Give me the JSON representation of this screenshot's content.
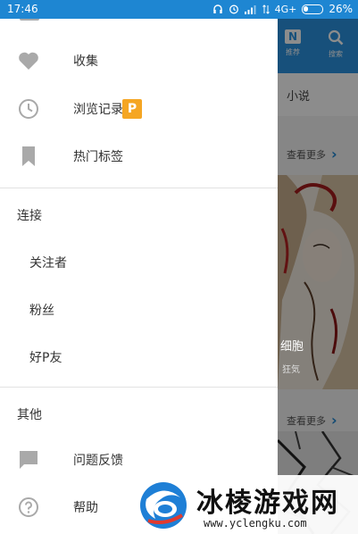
{
  "status_bar": {
    "time": "17:46",
    "network": "4G+",
    "battery": "26%",
    "battery_level": 0.26
  },
  "background_app": {
    "tabs": [
      {
        "label": "推荐",
        "icon": "n-logo-icon"
      },
      {
        "label": "搜索",
        "icon": "search-icon"
      }
    ],
    "section_label": "小说",
    "see_more_1": "查看更多",
    "see_more_2": "查看更多",
    "art_caption": "细胞",
    "art_subcaption": "狂気"
  },
  "drawer": {
    "items": [
      {
        "label": "收集",
        "icon": "heart-icon"
      },
      {
        "label": "浏览记录",
        "icon": "clock-icon",
        "badge": "P"
      },
      {
        "label": "热门标签",
        "icon": "bookmark-icon"
      }
    ],
    "connect_section": {
      "title": "连接",
      "items": [
        "关注者",
        "粉丝",
        "好P友"
      ]
    },
    "other_section": {
      "title": "其他",
      "items": [
        {
          "label": "问题反馈",
          "icon": "chat-bubble-icon"
        },
        {
          "label": "帮助",
          "icon": "help-icon"
        }
      ]
    }
  },
  "watermark": {
    "title": "冰棱游戏网",
    "url": "www.yclengku.com"
  },
  "colors": {
    "status_bar": "#1e86d2",
    "app_header": "#2a93e0",
    "badge": "#f5a623",
    "icon_gray": "#a9a9a9"
  }
}
